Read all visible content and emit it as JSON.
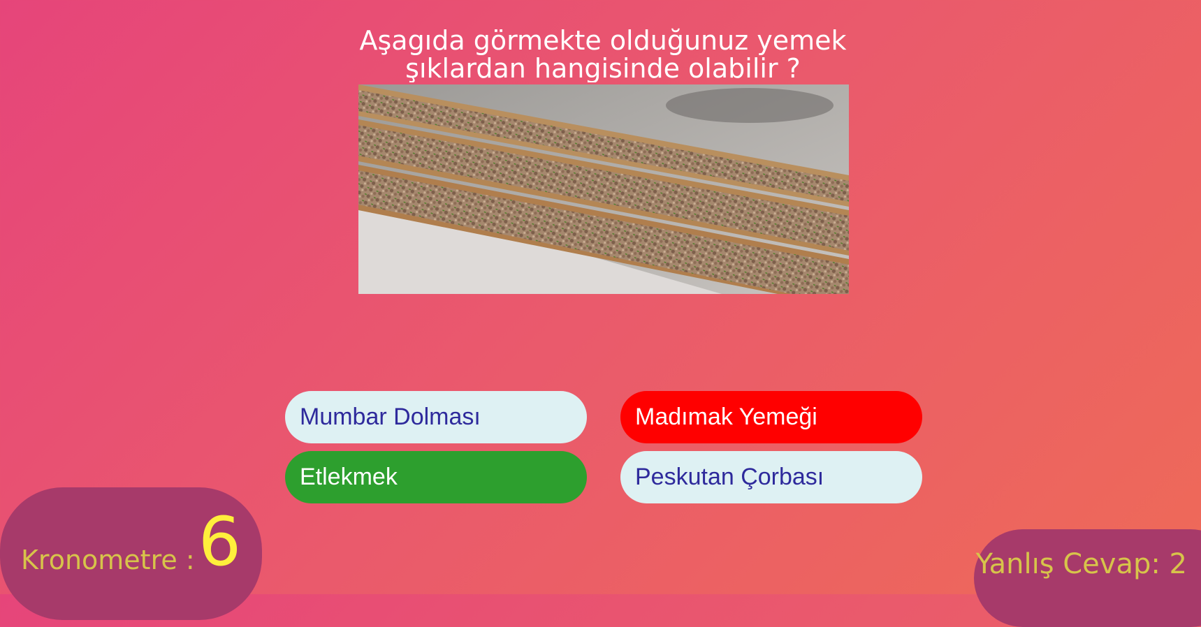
{
  "question": {
    "text": "Aşagıda görmekte olduğunuz yemek şıklardan hangisinde olabilir ?"
  },
  "image": {
    "subject": "food-photo-etlekmek"
  },
  "answers": [
    {
      "label": "Mumbar Dolması",
      "state": "neutral"
    },
    {
      "label": "Madımak Yemeği",
      "state": "wrong"
    },
    {
      "label": "Etlekmek",
      "state": "correct"
    },
    {
      "label": "Peskutan Çorbası",
      "state": "neutral"
    }
  ],
  "timer": {
    "label": "Kronometre :",
    "value": "6"
  },
  "score": {
    "wrong_text": "Yanlış Cevap: 2"
  },
  "colors": {
    "neutral_bg": "#def1f3",
    "wrong_bg": "#ff0000",
    "correct_bg": "#2d9f2e",
    "panel_bg": "#a73a6a",
    "timer_text": "#d7c44a",
    "timer_value": "#ffef3c"
  }
}
